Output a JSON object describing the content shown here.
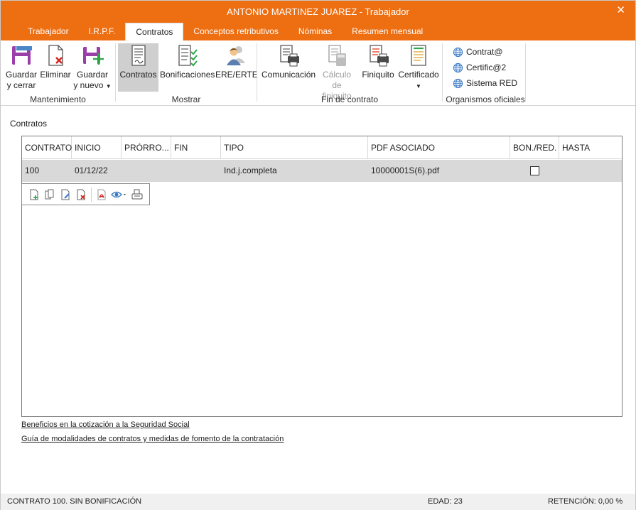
{
  "window": {
    "title": "ANTONIO MARTINEZ JUAREZ - Trabajador",
    "close_glyph": "✕"
  },
  "tabs": [
    {
      "label": "Trabajador",
      "active": false
    },
    {
      "label": "I.R.P.F.",
      "active": false
    },
    {
      "label": "Contratos",
      "active": true
    },
    {
      "label": "Conceptos retributivos",
      "active": false
    },
    {
      "label": "Nóminas",
      "active": false
    },
    {
      "label": "Resumen mensual",
      "active": false
    }
  ],
  "ribbon": {
    "mantenimiento": {
      "label": "Mantenimiento",
      "guardar_cerrar": [
        "Guardar",
        "y cerrar"
      ],
      "eliminar": "Eliminar",
      "guardar_nuevo": [
        "Guardar",
        "y nuevo"
      ]
    },
    "mostrar": {
      "label": "Mostrar",
      "contratos": "Contratos",
      "bonificaciones": "Bonificaciones",
      "ere": "ERE/ERTE"
    },
    "fin_contrato": {
      "label": "Fin de contrato",
      "comunicacion": "Comunicación",
      "calculo": [
        "Cálculo de",
        "finiquito"
      ],
      "finiquito": "Finiquito",
      "certificado": "Certificado"
    },
    "organismos": {
      "label": "Organismos oficiales",
      "contrata": "Contrat@",
      "certifica": "Certific@2",
      "sistema_red": "Sistema RED"
    }
  },
  "contratos": {
    "section_title": "Contratos",
    "columns": [
      "CONTRATO",
      "INICIO",
      "PRÓRRO...",
      "FIN",
      "TIPO",
      "PDF ASOCIADO",
      "BON./RED.",
      "HASTA"
    ],
    "rows": [
      {
        "contrato": "100",
        "inicio": "01/12/22",
        "prorroga": "",
        "fin": "",
        "tipo": "Ind.j.completa",
        "pdf": "10000001S(6).pdf",
        "bon_red": false,
        "hasta": ""
      }
    ]
  },
  "links": {
    "beneficios": "Beneficios en la cotización a la Seguridad Social",
    "guia": "Guía de modalidades de contratos y medidas de fomento de la contratación"
  },
  "status": {
    "contrato": "CONTRATO 100.  SIN BONIFICACIÓN",
    "edad": "EDAD: 23",
    "retencion": "RETENCIÓN: 0,00 %"
  },
  "colors": {
    "accent": "#ee6e12",
    "row_selected": "#d9d9d9"
  }
}
